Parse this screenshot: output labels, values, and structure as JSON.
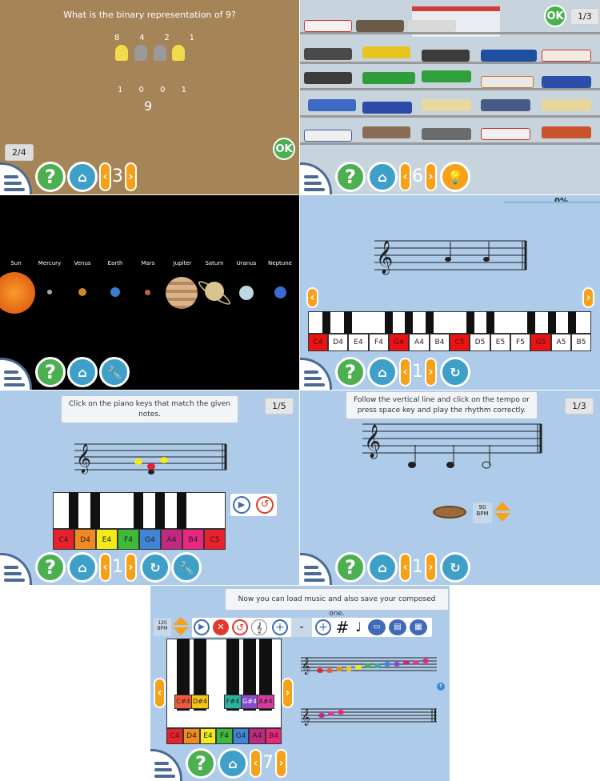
{
  "binary": {
    "question": "What is the binary representation of 9?",
    "weights": [
      "8",
      "4",
      "2",
      "1"
    ],
    "digits": [
      "1",
      "0",
      "0",
      "1"
    ],
    "result": "9",
    "progress": "2/4",
    "ok": "OK",
    "level": "3",
    "bulbs_on": [
      true,
      false,
      false,
      true
    ]
  },
  "trains": {
    "counter": "1/3",
    "ok": "OK",
    "level": "6"
  },
  "solar": {
    "planets": [
      "Sun",
      "Mercury",
      "Venus",
      "Earth",
      "Mars",
      "Jupiter",
      "Saturn",
      "Uranus",
      "Neptune"
    ],
    "colors": [
      "#e8560e",
      "#a9a9a9",
      "#c9892f",
      "#3b7bd0",
      "#c0623b",
      "#d8b58c",
      "#d8c48c",
      "#bcd8e0",
      "#3c6ad2"
    ]
  },
  "piano_quiz": {
    "percent": "0%",
    "keys": [
      "C4",
      "D4",
      "E4",
      "F4",
      "G4",
      "A4",
      "B4",
      "C5",
      "D5",
      "E5",
      "F5",
      "G5",
      "A5",
      "B5"
    ],
    "highlighted": [
      "C4",
      "G4",
      "C5",
      "G5"
    ],
    "level": "1"
  },
  "notes_game": {
    "instruction": "Click on the piano keys that match the given notes.",
    "counter": "1/5",
    "keys": [
      "C4",
      "D4",
      "E4",
      "F4",
      "G4",
      "A4",
      "B4",
      "C5"
    ],
    "key_colors": [
      "#e8212e",
      "#f08a1f",
      "#f4ea1a",
      "#3cba3c",
      "#3f86d6",
      "#c2287e",
      "#e8287e",
      "#e8212e"
    ],
    "level": "1"
  },
  "rhythm": {
    "instruction": "Follow the vertical line and click on the tempo or press space key and play the rhythm correctly.",
    "counter": "1/3",
    "bpm": "90",
    "bpm_unit": "BPM",
    "level": "1"
  },
  "composer": {
    "message": "Now you can load music and also save your composed one.",
    "bpm": "120",
    "bpm_unit": "BPM",
    "white_keys": [
      "C4",
      "D4",
      "E4",
      "F4",
      "G4",
      "A4",
      "B4"
    ],
    "white_colors": [
      "#e8212e",
      "#f08a1f",
      "#f4ea1a",
      "#3cba3c",
      "#3f86d6",
      "#c2287e",
      "#e8287e"
    ],
    "black_keys": [
      "C#4",
      "D#4",
      "F#4",
      "G#4",
      "A#4"
    ],
    "black_colors": [
      "#f05a3a",
      "#f4c41a",
      "#2ab3a0",
      "#8a4ad0",
      "#d63aa0"
    ],
    "sharp": "#",
    "minus": "-",
    "level": "7"
  }
}
